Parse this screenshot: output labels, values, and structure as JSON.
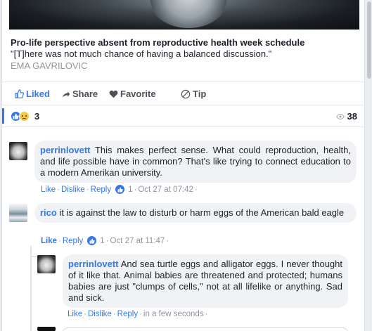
{
  "article": {
    "headline": "Pro-life perspective absent from reproductive health week schedule",
    "quote": "\"[T]here was not much chance of having a balanced discussion.\"",
    "author": "EMA GAVRILOVIC"
  },
  "actions": {
    "liked": "Liked",
    "share": "Share",
    "favorite": "Favorite",
    "tip": "Tip"
  },
  "stats": {
    "reactions": "3",
    "views": "38"
  },
  "comments": [
    {
      "user": "perrinlovett",
      "text": " This makes perfect sense. What could reproduction, health, and life possible have in common? That's like trying to connect education to a modern Amerikan university.",
      "like": "Like",
      "dislike": "Dislike",
      "reply": "Reply",
      "likes": "1",
      "time": "Oct 27 at 07:42"
    },
    {
      "user": "rico",
      "text": " it is against the law to disturb or harm eggs of the American bald eagle",
      "like": "Like",
      "reply": "Reply",
      "likes": "1",
      "time": "Oct 27 at 11:47"
    },
    {
      "user": "perrinlovett",
      "text": " And sea turtle eggs and alligator eggs. I never thought of it like that. Animal babies are threatened and protected; humans babies are just \"clumps of cells,\" not at all lifelike or anything. Sad and sick.",
      "like": "Like",
      "dislike": "Dislike",
      "reply": "Reply",
      "time": "in a few seconds"
    }
  ],
  "colors": {
    "accent": "#3578e5",
    "bubble": "#f0f2f5",
    "muted": "#90949c"
  }
}
